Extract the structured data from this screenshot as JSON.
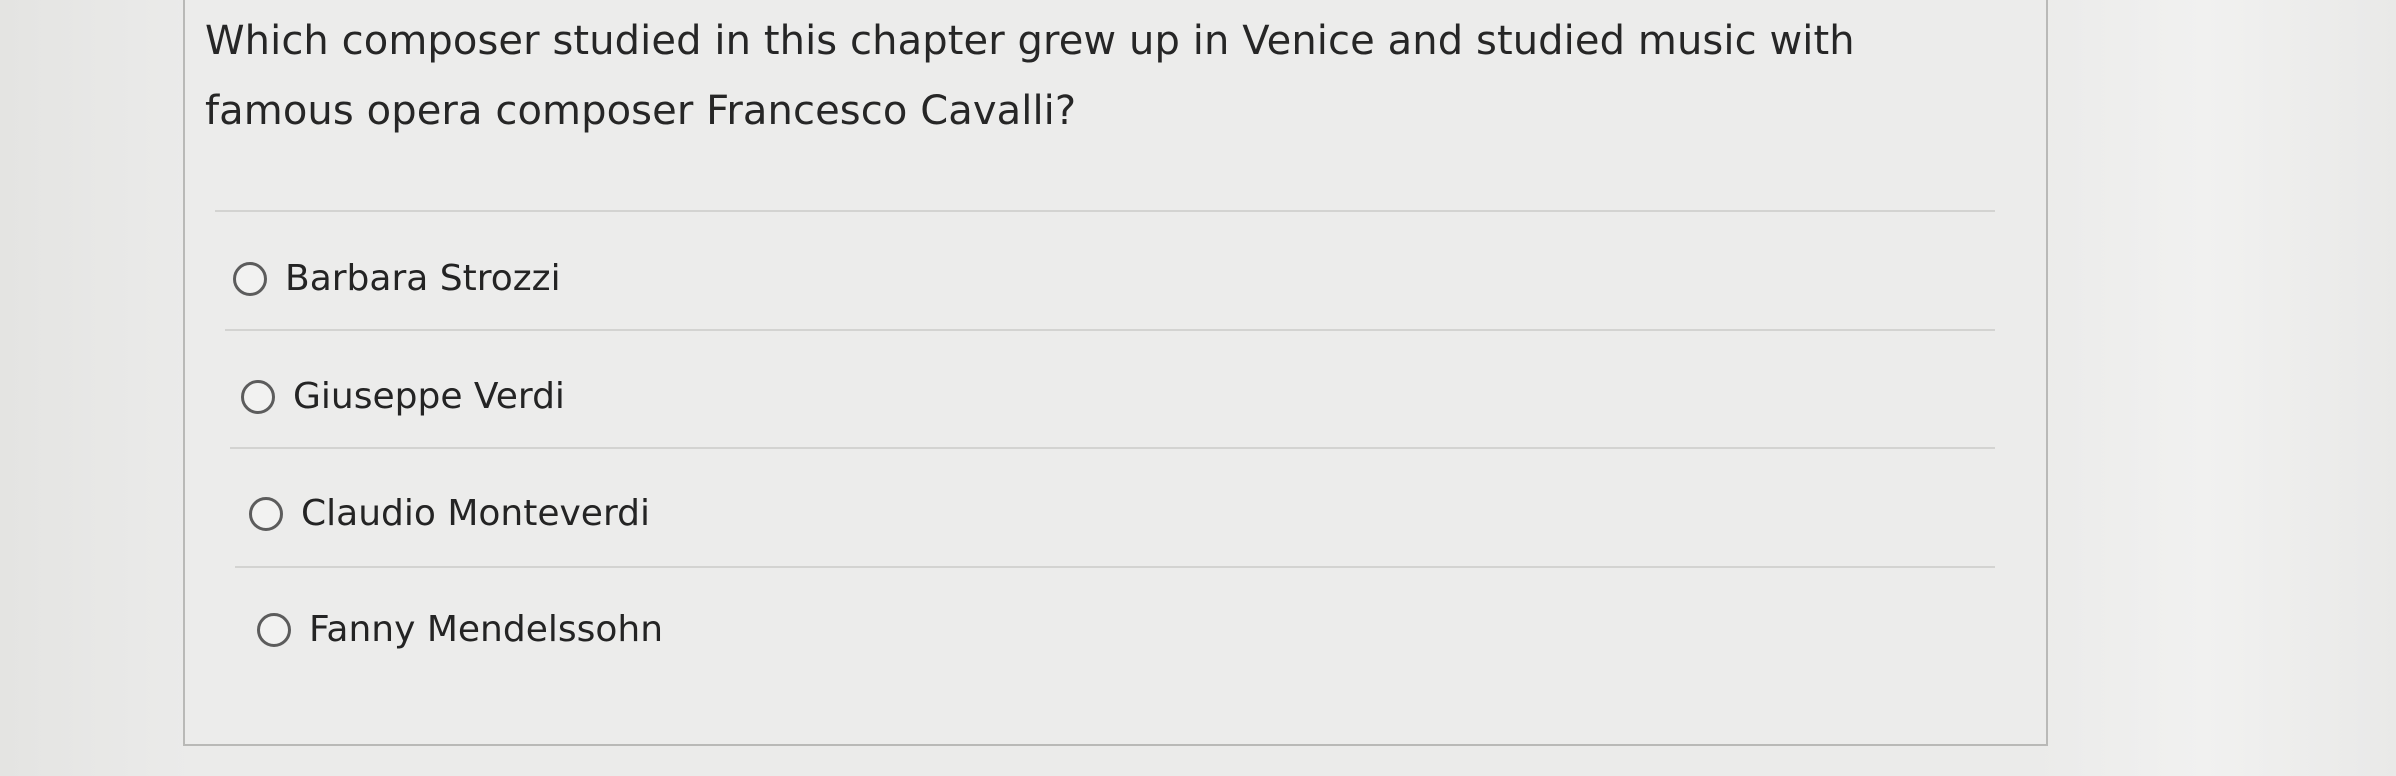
{
  "question": {
    "text": "Which composer studied in this chapter grew up in Venice and studied music with famous opera composer Francesco Cavalli?",
    "line_1": "Which composer studied in this chapter grew up in Venice and studied music with",
    "line_2": "famous opera composer Francesco Cavalli?"
  },
  "options": [
    {
      "label": "Barbara Strozzi",
      "selected": false
    },
    {
      "label": "Giuseppe Verdi",
      "selected": false
    },
    {
      "label": "Claudio Monteverdi",
      "selected": false
    },
    {
      "label": "Fanny Mendelssohn",
      "selected": false
    }
  ]
}
